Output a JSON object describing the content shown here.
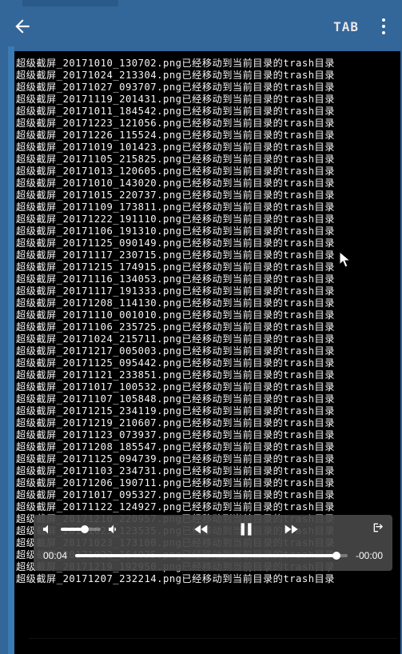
{
  "header": {
    "tab_label": "TAB"
  },
  "terminal": {
    "prefix": "超级截屏_",
    "suffix_msg": "已经移动到当前目录的trash目录",
    "ext": ".png",
    "files": [
      "20171010_130702",
      "20171024_213304",
      "20171027_093707",
      "20171119_201431",
      "20171011_184542",
      "20171223_121056",
      "20171226_115524",
      "20171019_101423",
      "20171105_215825",
      "20171013_120605",
      "20171010_143020",
      "20171015_220737",
      "20171109_173811",
      "20171222_191110",
      "20171106_191310",
      "20171125_090149",
      "20171117_230715",
      "20171215_174915",
      "20171116_134053",
      "20171117_191333",
      "20171208_114130",
      "20171110_001010",
      "20171106_235725",
      "20171024_215711",
      "20171217_005003",
      "20171125_095442",
      "20171121_233851",
      "20171017_100532",
      "20171107_105848",
      "20171215_234119",
      "20171219_210607",
      "20171123_073937",
      "20171208_185547",
      "20171125_094739",
      "20171103_234731",
      "20171206_190711",
      "20171017_095327",
      "20171122_124927",
      "20171210_220957",
      "20171023_123535",
      "20171023_173100",
      "20171022_164035",
      "20171219_192950",
      "20171207_232214"
    ],
    "footer_hint": ""
  },
  "player": {
    "elapsed": "00:04",
    "remaining": "-00:00"
  }
}
